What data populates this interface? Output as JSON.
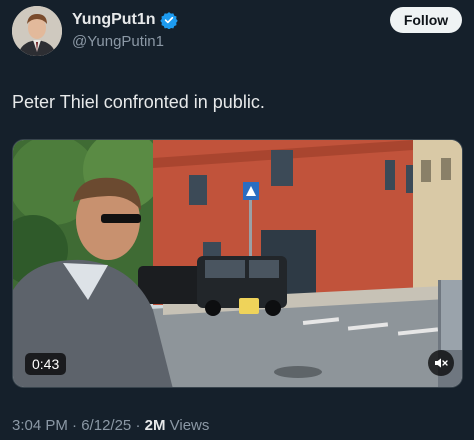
{
  "author": {
    "display_name": "YungPut1n",
    "handle": "@YungPutin1",
    "verified_icon": "verified-badge-icon",
    "verified_color": "#1d9bf0"
  },
  "follow_label": "Follow",
  "tweet_text": "Peter Thiel confronted in public.",
  "video": {
    "duration": "0:43",
    "mute_icon": "muted-speaker-icon"
  },
  "meta": {
    "time": "3:04 PM",
    "separator": "·",
    "date": "6/12/25",
    "views_count": "2M",
    "views_label": "Views"
  },
  "colors": {
    "background": "#15202b",
    "text": "#e7e9ea",
    "secondary_text": "#8b98a5",
    "follow_bg": "#eff3f4"
  }
}
